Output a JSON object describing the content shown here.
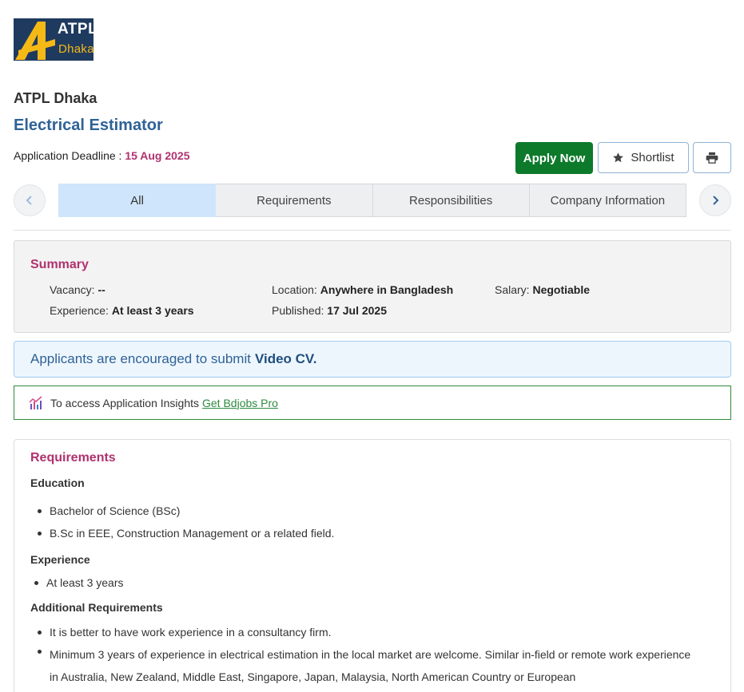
{
  "logo": {
    "line1": "ATPL",
    "line2": "Dhaka"
  },
  "company_name": "ATPL Dhaka",
  "job_title": "Electrical Estimator",
  "deadline": {
    "label": "Application Deadline :",
    "date": "15 Aug 2025"
  },
  "actions": {
    "apply": "Apply Now",
    "shortlist": "Shortlist",
    "print_icon": "printer-icon",
    "shortlist_icon": "star-icon"
  },
  "tabs": [
    "All",
    "Requirements",
    "Responsibilities",
    "Company Information"
  ],
  "active_tab": "All",
  "summary": {
    "heading": "Summary",
    "vacancy": {
      "label": "Vacancy:",
      "value": "--"
    },
    "location": {
      "label": "Location:",
      "value": "Anywhere in Bangladesh"
    },
    "salary": {
      "label": "Salary:",
      "value": "Negotiable"
    },
    "experience": {
      "label": "Experience:",
      "value": "At least 3 years"
    },
    "published": {
      "label": "Published:",
      "value": "17 Jul 2025"
    }
  },
  "video_cv": {
    "text": "Applicants are encouraged to submit",
    "highlight": "Video CV."
  },
  "insights": {
    "text": "To access Application Insights",
    "link": "Get Bdjobs Pro"
  },
  "requirements": {
    "heading": "Requirements",
    "education": {
      "title": "Education",
      "items": [
        "Bachelor of Science (BSc)",
        "B.Sc in EEE, Construction Management or a related field."
      ]
    },
    "experience": {
      "title": "Experience",
      "items": [
        "At least 3 years"
      ]
    },
    "additional": {
      "title": "Additional Requirements",
      "items": [
        "It is better to have work experience in a consultancy firm.",
        "Minimum 3 years of experience in electrical estimation in the local market are welcome. Similar in-field or remote work experience in Australia, New Zealand, Middle East, Singapore, Japan, Malaysia, North American Country or European"
      ]
    }
  },
  "colors": {
    "accent": "#2e6296",
    "heading": "#b0316e",
    "apply": "#0d7a2b",
    "link": "#2e8b3f"
  }
}
